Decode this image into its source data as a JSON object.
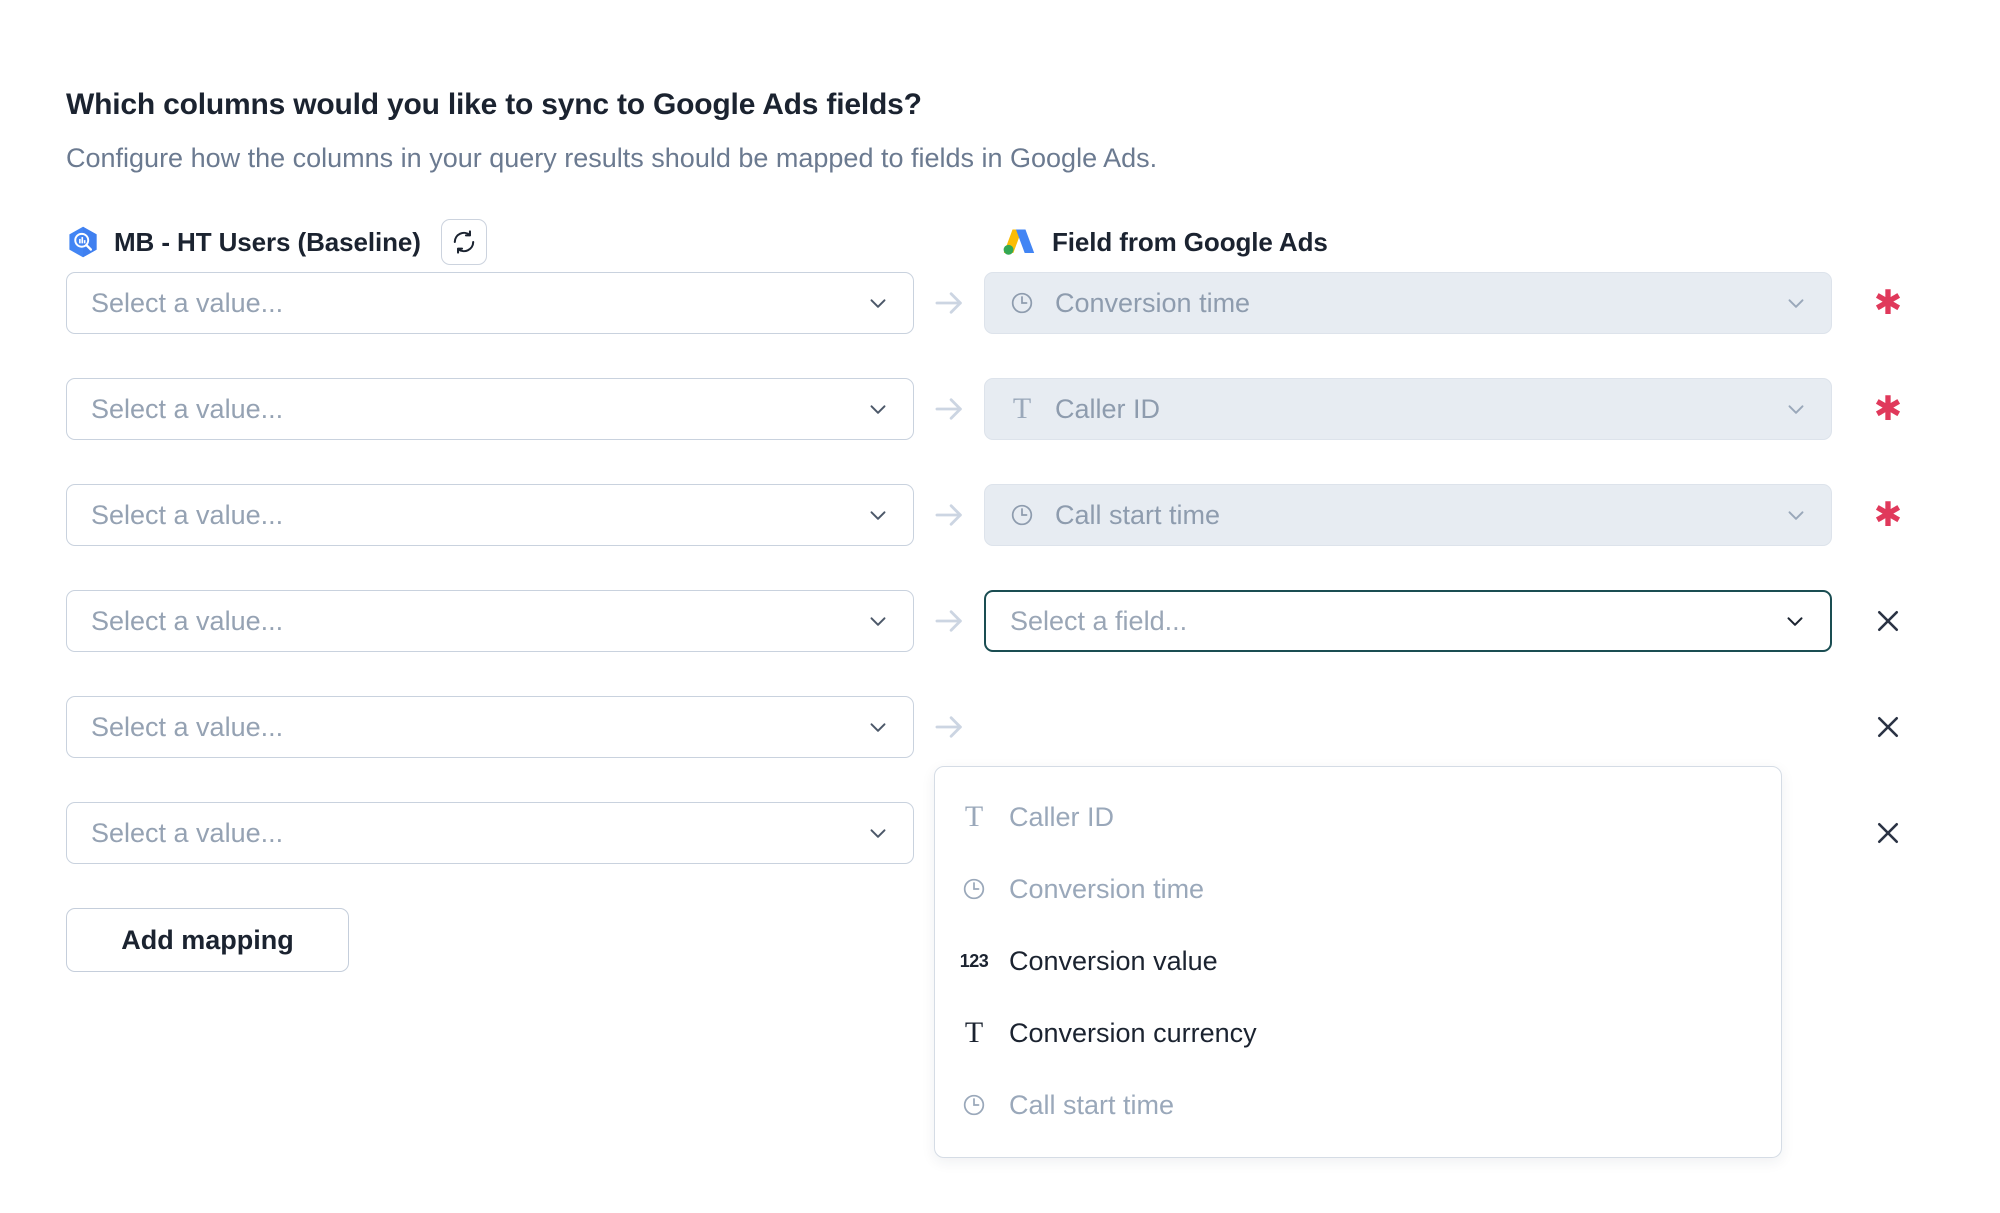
{
  "heading": "Which columns would you like to sync to Google Ads fields?",
  "subheading": "Configure how the columns in your query results should be mapped to fields in Google Ads.",
  "columns": {
    "left": {
      "label": "MB - HT Users (Baseline)",
      "icon": "bigquery-icon",
      "refresh_icon": "refresh-icon"
    },
    "right": {
      "label": "Field from Google Ads",
      "icon": "google-ads-icon"
    }
  },
  "source_placeholder": "Select a value...",
  "rows": [
    {
      "source_value": "Select a value...",
      "target_value": "Conversion time",
      "target_icon": "clock-icon",
      "target_state": "disabled",
      "marker": "required-asterisk"
    },
    {
      "source_value": "Select a value...",
      "target_value": "Caller ID",
      "target_icon": "text-icon",
      "target_state": "disabled",
      "marker": "required-asterisk"
    },
    {
      "source_value": "Select a value...",
      "target_value": "Call start time",
      "target_icon": "clock-icon",
      "target_state": "disabled",
      "marker": "required-asterisk"
    },
    {
      "source_value": "Select a value...",
      "target_value": "Select a field...",
      "target_icon": "none",
      "target_state": "focused",
      "marker": "remove-x"
    },
    {
      "source_value": "Select a value...",
      "target_value": "",
      "target_icon": "none",
      "target_state": "hidden",
      "marker": "remove-x"
    },
    {
      "source_value": "Select a value...",
      "target_value": "",
      "target_icon": "none",
      "target_state": "hidden",
      "marker": "remove-x"
    }
  ],
  "dropdown": {
    "options": [
      {
        "label": "Caller ID",
        "icon": "text-icon",
        "state": "disabled"
      },
      {
        "label": "Conversion time",
        "icon": "clock-icon",
        "state": "disabled"
      },
      {
        "label": "Conversion value",
        "icon": "number-icon",
        "state": "enabled"
      },
      {
        "label": "Conversion currency",
        "icon": "text-icon",
        "state": "enabled"
      },
      {
        "label": "Call start time",
        "icon": "clock-icon",
        "state": "disabled"
      }
    ]
  },
  "add_mapping_label": "Add mapping",
  "colors": {
    "heading": "#1b2330",
    "muted": "#6b7a90",
    "placeholder": "#95a2b3",
    "focus_border": "#1a4d52",
    "required": "#e0395b",
    "disabled_bg": "#e7ecf2",
    "border": "#c9d2de"
  }
}
